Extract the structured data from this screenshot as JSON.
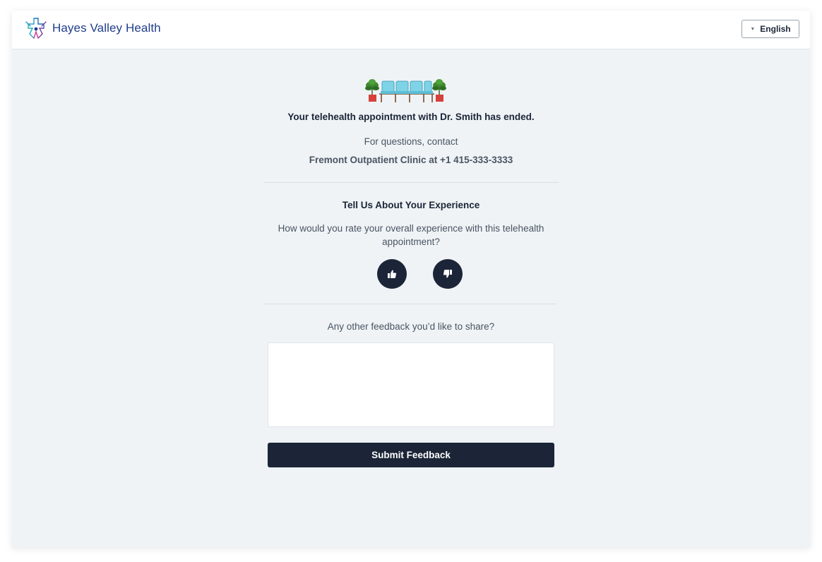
{
  "header": {
    "brand_name": "Hayes Valley Health",
    "logo_icon": "medical-cross-logo-icon",
    "language_button": {
      "label": "English",
      "icon": "caret-down-icon"
    }
  },
  "visit_summary": {
    "illustration": "waiting-room-chairs-illustration",
    "title": "Your telehealth appointment with Dr. Smith has ended.",
    "contact_intro": "For questions, contact",
    "contact_clinic": "Fremont Outpatient Clinic at +1 415-333-3333"
  },
  "rating": {
    "title": "Tell Us About Your Experience",
    "question": "How would you rate your overall experience with this telehealth appointment?",
    "thumbs_up_icon": "thumbs-up-icon",
    "thumbs_down_icon": "thumbs-down-icon"
  },
  "feedback": {
    "label": "Any other feedback you’d like to share?",
    "value": "",
    "submit_label": "Submit Feedback"
  },
  "colors": {
    "navy": "#1b2537",
    "brand_blue": "#1f3d8a",
    "page_background": "#eff3f6"
  }
}
